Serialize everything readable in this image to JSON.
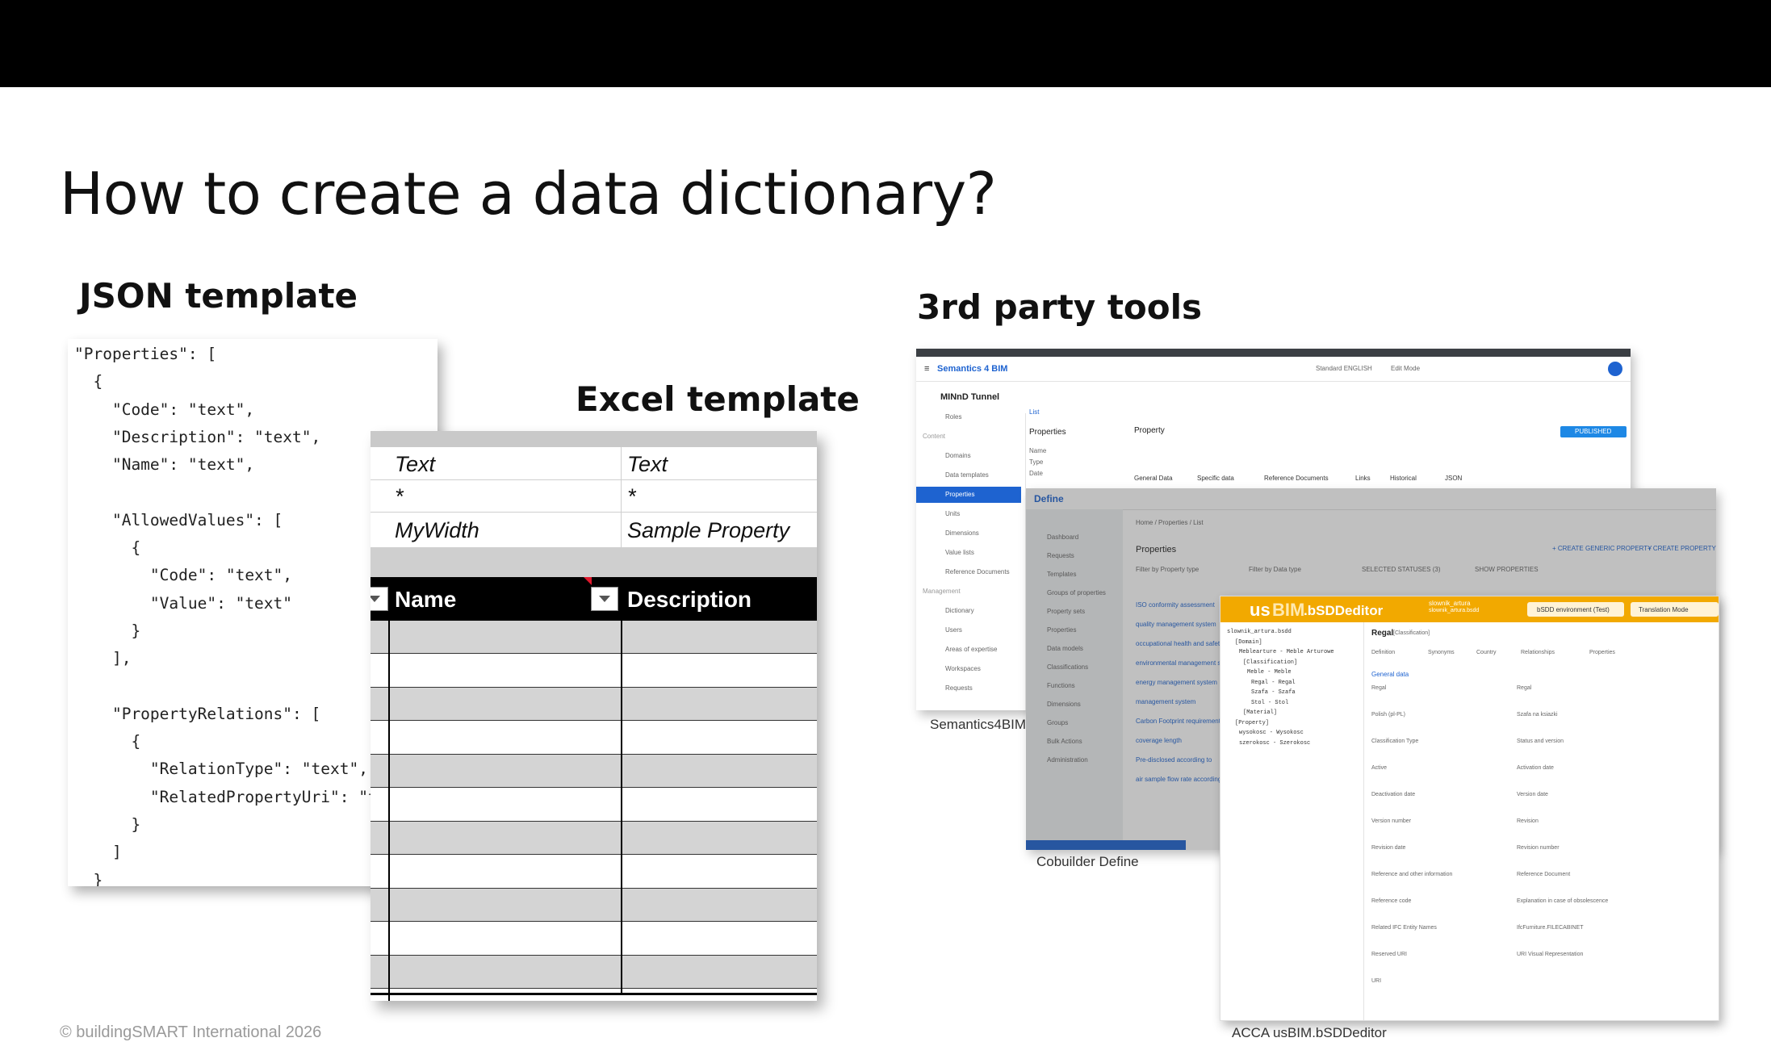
{
  "slide": {
    "title": "How to create a data dictionary?",
    "footer": "© buildingSMART International 2026"
  },
  "json_template": {
    "heading": "JSON template",
    "code": "\"Properties\": [\n  {\n    \"Code\": \"text\",\n    \"Description\": \"text\",\n    \"Name\": \"text\",\n\n    \"AllowedValues\": [\n      {\n        \"Code\": \"text\",\n        \"Value\": \"text\"\n      }\n    ],\n\n    \"PropertyRelations\": [\n      {\n        \"RelationType\": \"text\",\n        \"RelatedPropertyUri\": \"text\"\n      }\n    ]\n  }"
  },
  "excel_template": {
    "heading": "Excel template",
    "rows": [
      {
        "a": "Text",
        "b": "Text"
      },
      {
        "a": "*",
        "b": "*"
      },
      {
        "a": "MyWidth",
        "b": "Sample Property"
      }
    ],
    "col_name": "Name",
    "col_description": "Description"
  },
  "third_party": {
    "heading": "3rd party tools",
    "tools": [
      {
        "caption": "Semantics4BIM"
      },
      {
        "caption": "Cobuilder Define"
      },
      {
        "caption": "ACCA usBIM.bSDDeditor"
      }
    ]
  },
  "semantics4bim": {
    "project": "MINnD Tunnel",
    "panel_title": "Properties",
    "property_label": "Property",
    "publish_label": "PUBLISHED",
    "language": "Standard ENGLISH",
    "mode": "Edit Mode",
    "sidebar": [
      "Roles",
      "Content",
      "Domains",
      "Data templates",
      "Properties",
      "Units",
      "Dimensions",
      "Value lists",
      "Reference Documents",
      "Management",
      "Dictionary",
      "Users",
      "Areas of expertise",
      "Workspaces",
      "Requests"
    ],
    "tabs": [
      "General Data",
      "Specific data",
      "Reference Documents",
      "Links",
      "Historical",
      "JSON"
    ],
    "list_tab": "List",
    "list_fields": [
      "Name",
      "Type",
      "Date"
    ]
  },
  "cobuilder": {
    "brand": "Define",
    "breadcrumb": "Home  /  Properties  /  List",
    "heading": "Properties",
    "btn_generic": "+ CREATE GENERIC PROPERTY",
    "btn_property": "+ CREATE PROPERTY",
    "filters": [
      "Filter by Property type",
      "Filter by Data type",
      "SELECTED STATUSES (3)",
      "SHOW PROPERTIES"
    ],
    "sidebar": [
      "Dashboard",
      "Requests",
      "Templates",
      "Groups of properties",
      "Property sets",
      "Properties",
      "Data models",
      "Classifications",
      "Functions",
      "Dimensions",
      "Groups",
      "Bulk Actions",
      "Administration"
    ],
    "rows": [
      "ISO conformity assessment",
      "quality management system",
      "occupational health and safety",
      "environmental management system",
      "energy management system",
      "management system",
      "Carbon Footprint requirement",
      "coverage length",
      "Pre-disclosed according to",
      "air sample flow rate according"
    ]
  },
  "usbim": {
    "logo_left": "us",
    "logo_mid": "BIM",
    "logo_right": ".bSDDeditor",
    "dict_name": "slownik_artura",
    "dict_sub": "slownik_artura.bsdd",
    "env_label": "bSDD environment (Test)",
    "translate_label": "Translation Mode",
    "tree": [
      "slownik_artura.bsdd",
      "[Domain]",
      "Meblearture - Meble Arturowe",
      "[Classification]",
      "Meble - Meble",
      "Regal - Regal",
      "Szafa - Szafa",
      "Stol - Stol",
      "[Material]",
      "[Property]",
      "wysokosc - Wysokosc",
      "szerokosc - Szerokosc"
    ],
    "class_title": "Regal",
    "class_type": "[Classification]",
    "tabs": [
      "Definition",
      "Synonyms",
      "Country",
      "Relationships",
      "Properties"
    ],
    "section_general": "General data",
    "fields": [
      "Regal",
      "Regal",
      "Polish (pl-PL)",
      "Szafa na ksiazki",
      "Classification Type",
      "Status and version",
      "Active",
      "Activation date",
      "Deactivation date",
      "Version date",
      "Version number",
      "Revision",
      "Revision date",
      "Revision number",
      "Reference and other information",
      "Reference Document",
      "Reference code",
      "Explanation in case of obsolescence",
      "Related IFC Entity Names",
      "IfcFurniture.FILECABINET",
      "Reserved URI",
      "URI Visual Representation",
      "URI"
    ]
  },
  "colors": {
    "topbar": "#000000",
    "accent_blue": "#1e63d0",
    "usbim_orange": "#f2a900",
    "excel_gray": "#d4d4d4"
  }
}
